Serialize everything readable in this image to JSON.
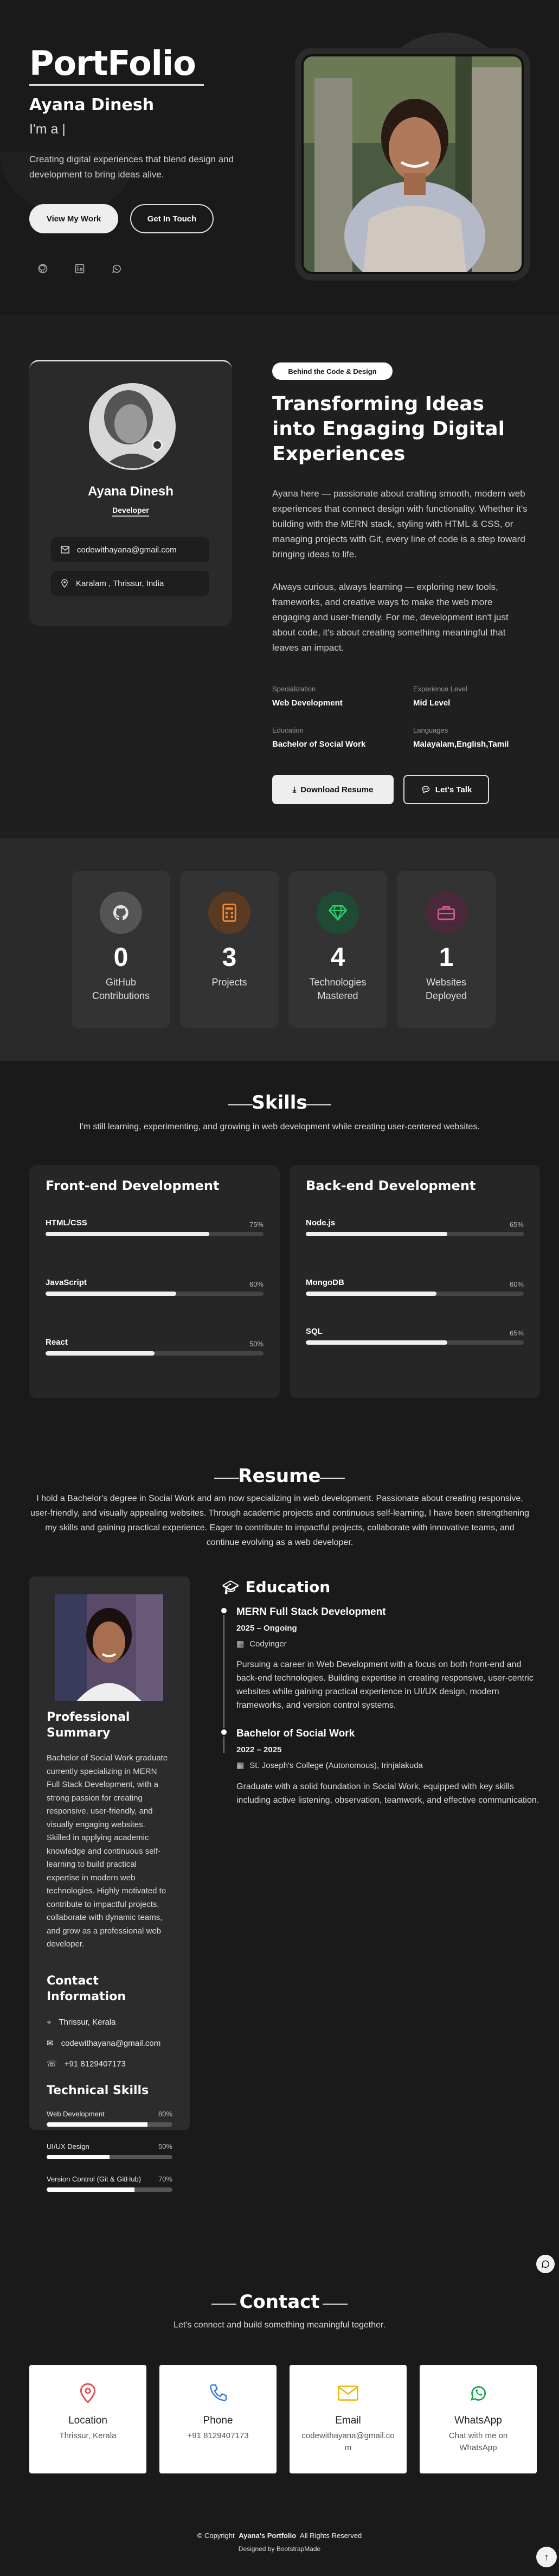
{
  "hero": {
    "logo": "PortFolio",
    "name": "Ayana Dinesh",
    "typing": "I'm a |",
    "description": "Creating digital experiences that blend design and development to bring ideas alive.",
    "btn_work": "View My Work",
    "btn_touch": "Get In Touch",
    "socials": [
      "github-icon",
      "linkedin-icon",
      "whatsapp-icon"
    ]
  },
  "about": {
    "card_name": "Ayana Dinesh",
    "card_role": "Developer",
    "email": "codewithayana@gmail.com",
    "location": "Karalam , Thrissur, India",
    "badge": "Behind the Code & Design",
    "title": "Transforming Ideas into Engaging Digital Experiences",
    "p1": "Ayana here — passionate about crafting smooth, modern web experiences that connect design with functionality. Whether it's building with the MERN stack, styling with HTML & CSS, or managing projects with Git, every line of code is a step toward bringing ideas to life.",
    "p2": "Always curious, always learning — exploring new tools, frameworks, and creative ways to make the web more engaging and user-friendly. For me, development isn't just about code, it's about creating something meaningful that leaves an impact.",
    "facts": [
      {
        "k": "Specialization",
        "v": "Web Development"
      },
      {
        "k": "Experience Level",
        "v": "Mid Level"
      },
      {
        "k": "Education",
        "v": "Bachelor of Social Work"
      },
      {
        "k": "Languages",
        "v": "Malayalam,English,Tamil"
      }
    ],
    "btn_resume": "Download Resume",
    "btn_talk": "Let's Talk"
  },
  "stats": [
    {
      "num": "0",
      "label": "GitHub Contributions",
      "icon": "github-icon",
      "color": "#555555"
    },
    {
      "num": "3",
      "label": "Projects",
      "icon": "projects-icon",
      "color": "#5a3a22"
    },
    {
      "num": "4",
      "label": "Technologies Mastered",
      "icon": "gem-icon",
      "color": "#1f4a33"
    },
    {
      "num": "1",
      "label": "Websites Deployed",
      "icon": "briefcase-icon",
      "color": "#4a2a3a"
    }
  ],
  "skills": {
    "title": "Skills",
    "subtitle": "I'm still learning, experimenting, and growing in web development while creating user-centered websites.",
    "frontend": {
      "title": "Front-end Development",
      "items": [
        {
          "name": "HTML/CSS",
          "pct": "75%",
          "value": 75
        },
        {
          "name": "JavaScript",
          "pct": "60%",
          "value": 60
        },
        {
          "name": "React",
          "pct": "50%",
          "value": 50
        }
      ]
    },
    "backend": {
      "title": "Back-end Development",
      "items": [
        {
          "name": "Node.js",
          "pct": "65%",
          "value": 65
        },
        {
          "name": "MongoDB",
          "pct": "60%",
          "value": 60
        },
        {
          "name": "SQL",
          "pct": "65%",
          "value": 65
        }
      ]
    }
  },
  "resume": {
    "title": "Resume",
    "intro": "I hold a Bachelor's degree in Social Work and am now specializing in web development. Passionate about creating responsive, user-friendly, and visually appealing websites. Through academic projects and continuous self-learning, I have been strengthening my skills and gaining practical experience. Eager to contribute to impactful projects, collaborate with innovative teams, and continue evolving as a web developer.",
    "summary_title": "Professional Summary",
    "summary": "Bachelor of Social Work graduate currently specializing in MERN Full Stack Development, with a strong passion for creating responsive, user-friendly, and visually engaging websites. Skilled in applying academic knowledge and continuous self-learning to build practical expertise in modern web technologies. Highly motivated to contribute to impactful projects, collaborate with dynamic teams, and grow as a professional web developer.",
    "contact_title": "Contact Information",
    "contact": [
      {
        "icon": "location-icon",
        "text": "Thrissur, Kerala"
      },
      {
        "icon": "mail-icon",
        "text": "codewithayana@gmail.com"
      },
      {
        "icon": "phone-icon",
        "text": "+91 8129407173"
      }
    ],
    "tech_title": "Technical Skills",
    "tech": [
      {
        "name": "Web Development",
        "pct": "80%",
        "value": 80
      },
      {
        "name": "UI/UX Design",
        "pct": "50%",
        "value": 50
      },
      {
        "name": "Version Control (Git & GitHub)",
        "pct": "70%",
        "value": 70
      }
    ],
    "education_title": "Education",
    "education": [
      {
        "title": "MERN Full Stack Development",
        "years": "2025 – Ongoing",
        "org": "Codyinger",
        "desc": "Pursuing a career in Web Development with a focus on both front-end and back-end technologies. Building expertise in creating responsive, user-centric websites while gaining practical experience in UI/UX design, modern frameworks, and version control systems."
      },
      {
        "title": "Bachelor of Social Work",
        "years": "2022 – 2025",
        "org": "St. Joseph's College (Autonomous), Irinjalakuda",
        "desc": "Graduate with a solid foundation in Social Work, equipped with key skills including active listening, observation, teamwork, and effective communication."
      }
    ]
  },
  "contact": {
    "title": "Contact",
    "subtitle": "Let's connect and build something meaningful together.",
    "cards": [
      {
        "title": "Location",
        "value": "Thrissur, Kerala",
        "icon": "location-icon",
        "color": "#e05555"
      },
      {
        "title": "Phone",
        "value": "+91 8129407173",
        "icon": "phone-icon",
        "color": "#2f7be0"
      },
      {
        "title": "Email",
        "value": "codewithayana@gmail.com",
        "icon": "mail-icon",
        "color": "#f0b400"
      },
      {
        "title": "WhatsApp",
        "value": "Chat with me on WhatsApp",
        "icon": "whatsapp-icon",
        "color": "#1aa34a"
      }
    ]
  },
  "footer": {
    "copy_prefix": "© Copyright",
    "brand": "Ayana's Portfolio",
    "rights": "All Rights Reserved",
    "designed": "Designed by BootstrapMade"
  }
}
